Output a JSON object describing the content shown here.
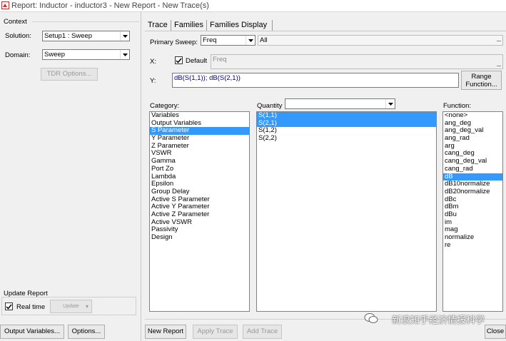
{
  "window": {
    "title": "Report: Inductor - inductor3 - New Report - New Trace(s)"
  },
  "context": {
    "heading": "Context",
    "solution_label": "Solution:",
    "solution_value": "Setup1 : Sweep",
    "domain_label": "Domain:",
    "domain_value": "Sweep",
    "tdr_button": "TDR Options..."
  },
  "update_report": {
    "heading": "Update Report",
    "realtime_label": "Real time",
    "realtime_checked": true,
    "update_button": "Update"
  },
  "bottom_left": {
    "output_variables_button": "Output Variables...",
    "options_button": "Options..."
  },
  "tabs": [
    {
      "label": "Trace",
      "active": true
    },
    {
      "label": "Families",
      "active": false
    },
    {
      "label": "Families Display",
      "active": false
    }
  ],
  "trace": {
    "primary_sweep_label": "Primary Sweep:",
    "primary_sweep_value": "Freq",
    "primary_sweep_range": "All",
    "x_label": "X:",
    "default_label": "Default",
    "default_checked": true,
    "x_value": "Freq",
    "y_label": "Y:",
    "y_value": "dB(S(1,1)); dB(S(2,1))",
    "range_function_button": [
      "Range",
      "Function..."
    ]
  },
  "category": {
    "label": "Category:",
    "items": [
      "Variables",
      "Output Variables",
      "S Parameter",
      "Y Parameter",
      "Z Parameter",
      "VSWR",
      "Gamma",
      "Port Zo",
      "Lambda",
      "Epsilon",
      "Group Delay",
      "Active S Parameter",
      "Active Y Parameter",
      "Active Z Parameter",
      "Active VSWR",
      "Passivity",
      "Design"
    ],
    "selected": [
      "S Parameter"
    ]
  },
  "quantity": {
    "label": "Quantity",
    "filter_value": "",
    "items": [
      "S(1,1)",
      "S(2,1)",
      "S(1,2)",
      "S(2,2)"
    ],
    "selected": [
      "S(1,1)",
      "S(2,1)"
    ]
  },
  "function": {
    "label": "Function:",
    "items": [
      "<none>",
      "ang_deg",
      "ang_deg_val",
      "ang_rad",
      "arg",
      "cang_deg",
      "cang_deg_val",
      "cang_rad",
      "dB",
      "dB10normalize",
      "dB20normalize",
      "dBc",
      "dBm",
      "dBu",
      "im",
      "mag",
      "normalize",
      "re"
    ],
    "selected": [
      "dB"
    ]
  },
  "bottom_right": {
    "new_report": "New Report",
    "apply_trace": "Apply Trace",
    "add_trace": "Add Trace",
    "close": "Close"
  },
  "watermark": "新浪知乎经济情报科学",
  "colors": {
    "selection": "#3399ff",
    "field_text": "#00008b"
  },
  "icons": [
    "app-icon",
    "chevron-down-icon",
    "checkmark-icon",
    "wechat-icon"
  ]
}
